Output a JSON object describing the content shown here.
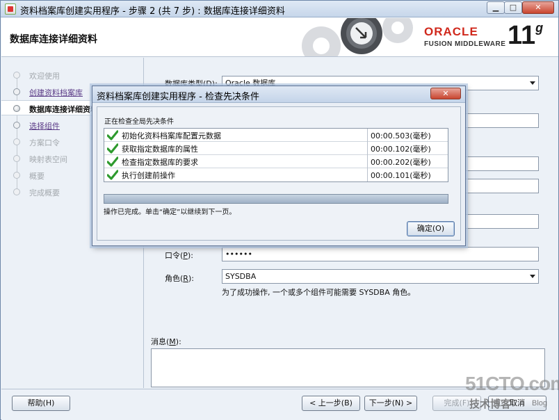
{
  "window": {
    "title": "资料档案库创建实用程序 - 步骤 2 (共 7 步) : 数据库连接详细资料",
    "min_label": "▁",
    "max_label": "□",
    "close_label": "✕"
  },
  "header": {
    "page_title": "数据库连接详细资料",
    "brand": "ORACLE",
    "brand_sub": "FUSION MIDDLEWARE",
    "version": "11",
    "version_sup": "g"
  },
  "steps": [
    {
      "label": "欢迎使用",
      "state": "done"
    },
    {
      "label": "创建资料档案库",
      "state": "link"
    },
    {
      "label": "数据库连接详细资料",
      "state": "current"
    },
    {
      "label": "选择组件",
      "state": "link"
    },
    {
      "label": "方案口令",
      "state": "pending"
    },
    {
      "label": "映射表空间",
      "state": "pending"
    },
    {
      "label": "概要",
      "state": "pending"
    },
    {
      "label": "完成概要",
      "state": "pending"
    }
  ],
  "form": {
    "dbtype_label": "数据库类型(",
    "dbtype_key": "D",
    "dbtype_label_end": "):",
    "dbtype_value": "Oracle 数据库",
    "password_label": "口令(",
    "password_key": "P",
    "password_label_end": "):",
    "password_value": "••••••",
    "role_label": "角色(",
    "role_key": "R",
    "role_label_end": "):",
    "role_value": "SYSDBA",
    "role_hint": "为了成功操作, 一个或多个组件可能需要 SYSDBA 角色。",
    "message_label": "消息(",
    "message_key": "M",
    "message_label_end": "):"
  },
  "buttons": {
    "help": "帮助(H)",
    "back": "< 上一步(B)",
    "next": "下一步(N) >",
    "finish": "完成(F)",
    "cancel": "取消"
  },
  "dialog": {
    "title": "资料档案库创建实用程序 - 检查先决条件",
    "close_label": "✕",
    "heading": "正在检查全局先决条件",
    "checks": [
      {
        "name": "初始化资料档案库配置元数据",
        "time": "00:00.503(毫秒)",
        "status": "passed"
      },
      {
        "name": "获取指定数据库的属性",
        "time": "00:00.102(毫秒)",
        "status": "passed"
      },
      {
        "name": "检查指定数据库的要求",
        "time": "00:00.202(毫秒)",
        "status": "passed"
      },
      {
        "name": "执行创建前操作",
        "time": "00:00.101(毫秒)",
        "status": "passed"
      }
    ],
    "progress": 1.0,
    "status_text": "操作已完成。单击“确定”以继续到下一页。",
    "ok_label": "确定(O)"
  },
  "watermark": {
    "site": "51CTO.com",
    "line": "技术博客",
    "blog": "Blog"
  },
  "colors": {
    "brand_red": "#d0281c",
    "check_green": "#2e9a2e",
    "link_purple": "#5a3a86"
  },
  "icons": {
    "check": "check-icon",
    "app": "app-icon"
  }
}
